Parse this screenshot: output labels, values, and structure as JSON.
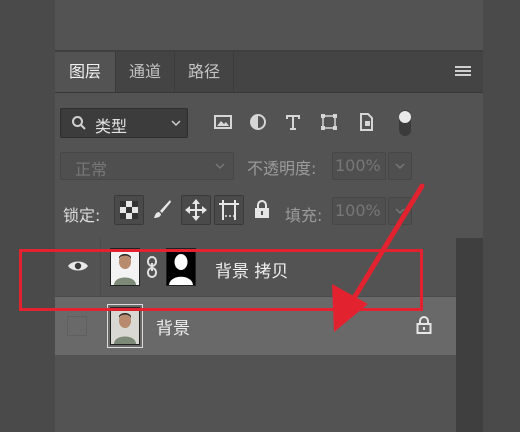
{
  "tabs": [
    {
      "label": "图层",
      "active": true
    },
    {
      "label": "通道",
      "active": false
    },
    {
      "label": "路径",
      "active": false
    }
  ],
  "filter": {
    "label": "类型",
    "icons": [
      "image-filter-icon",
      "adjustment-filter-icon",
      "text-filter-icon",
      "shape-filter-icon",
      "smart-object-filter-icon",
      "filter-toggle-icon"
    ]
  },
  "blend": {
    "mode": "正常",
    "opacity_label": "不透明度:",
    "opacity_value": "100%"
  },
  "lock": {
    "label": "锁定:",
    "fill_label": "填充:",
    "fill_value": "100%",
    "icons": [
      "lock-transparent-pixels-icon",
      "lock-image-pixels-icon",
      "lock-position-icon",
      "lock-artboard-icon",
      "lock-all-icon"
    ]
  },
  "layers": [
    {
      "name": "背景 拷贝",
      "visible": true,
      "has_mask": true,
      "selected": false,
      "locked": false
    },
    {
      "name": "背景",
      "visible": false,
      "has_mask": false,
      "selected": true,
      "locked": true
    }
  ],
  "annotation": {
    "highlight_color": "#e2232f"
  }
}
